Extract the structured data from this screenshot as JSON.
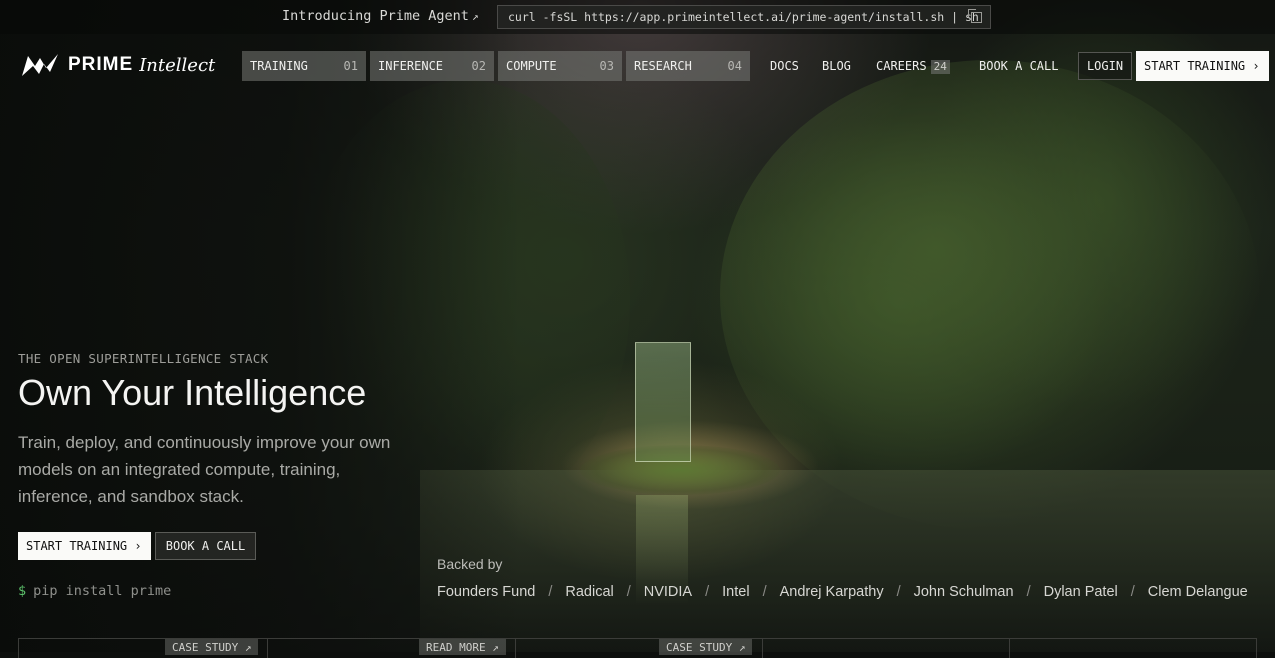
{
  "topbar": {
    "intro_label": "Introducing Prime Agent",
    "intro_arrow": "↗",
    "install_command": "curl -fsSL https://app.primeintellect.ai/prime-agent/install.sh | sh"
  },
  "brand": {
    "name_bold": "PRIME",
    "name_italic": "Intellect"
  },
  "nav": {
    "boxes": [
      {
        "label": "TRAINING",
        "num": "01"
      },
      {
        "label": "INFERENCE",
        "num": "02"
      },
      {
        "label": "COMPUTE",
        "num": "03"
      },
      {
        "label": "RESEARCH",
        "num": "04"
      }
    ],
    "docs": "DOCS",
    "blog": "BLOG",
    "careers": "CAREERS",
    "careers_count": "24",
    "book_call": "BOOK A CALL",
    "login": "LOGIN",
    "start_training": "START TRAINING",
    "chevron": "›"
  },
  "hero": {
    "eyebrow": "THE OPEN SUPERINTELLIGENCE STACK",
    "headline": "Own Your Intelligence",
    "subtitle": "Train, deploy, and continuously improve your own models on an integrated compute, training, inference, and sandbox stack.",
    "start_training": "START TRAINING",
    "chevron": "›",
    "book_call": "BOOK A CALL",
    "prompt": "$",
    "pip_command": "pip install prime"
  },
  "backed": {
    "label": "Backed by",
    "backers": [
      "Founders Fund",
      "Radical",
      "NVIDIA",
      "Intel",
      "Andrej Karpathy",
      "John Schulman",
      "Dylan Patel",
      "Clem Delangue"
    ],
    "separator": "/"
  },
  "cards": {
    "tags": [
      "CASE STUDY ↗",
      "READ MORE ↗",
      "CASE STUDY ↗"
    ]
  },
  "colors": {
    "accent_green": "#5bbf6a",
    "button_white": "#fafaf8"
  }
}
